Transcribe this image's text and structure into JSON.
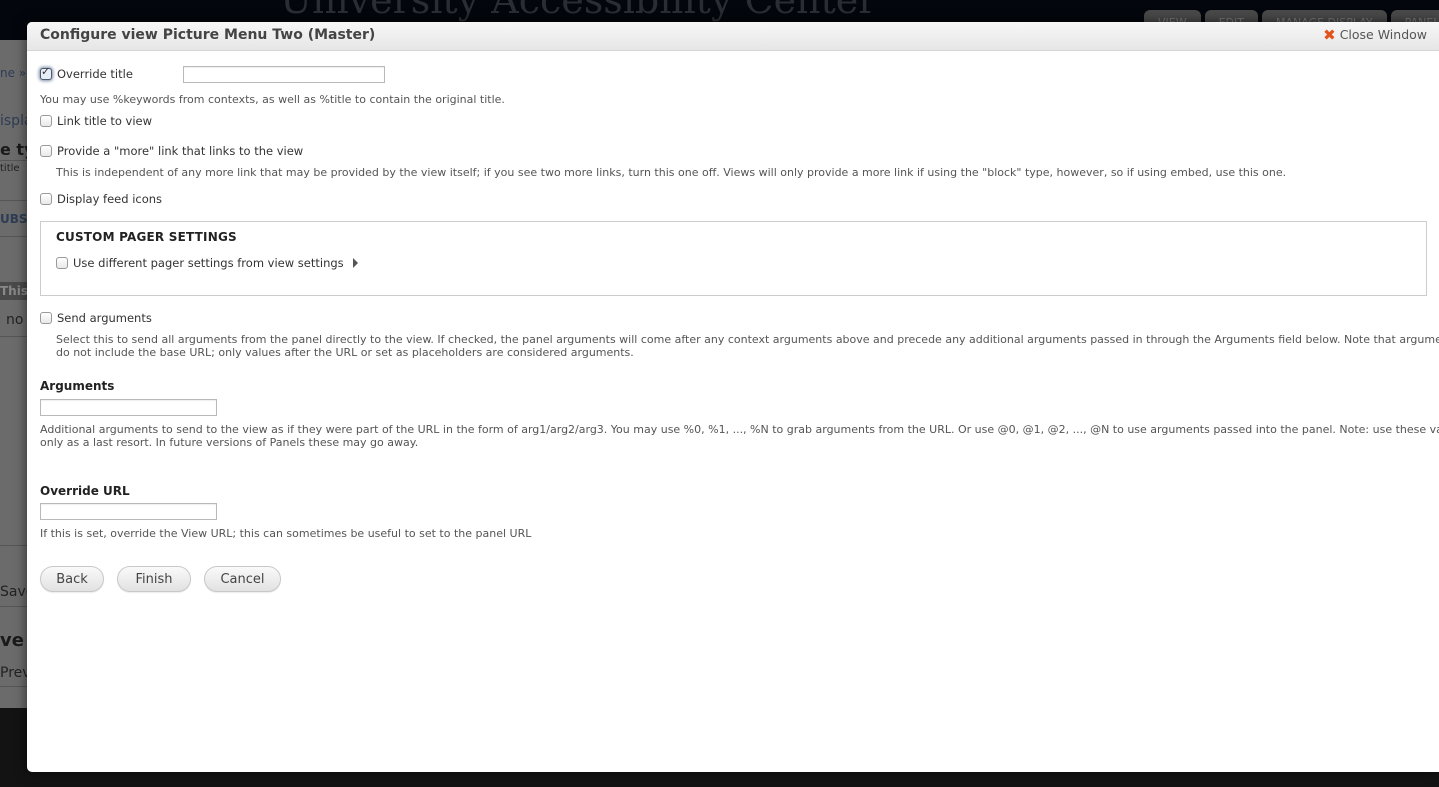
{
  "background": {
    "site_title": "University Accessibility Center",
    "tabs": [
      "VIEW",
      "EDIT",
      "MANAGE DISPLAY",
      "PANEL"
    ],
    "fragments": [
      "ne » L",
      "ispla",
      "e ty",
      "title",
      "UBS",
      "This",
      "no",
      "Save",
      "ve p",
      "Previ"
    ]
  },
  "modal": {
    "title": "Configure view Picture Menu Two (Master)",
    "close_label": "Close Window",
    "close_icon": "x-icon",
    "accent_color": "#e2531c"
  },
  "form": {
    "override_title": {
      "label": "Override title",
      "checked": true,
      "value": "",
      "help": "You may use %keywords from contexts, as well as %title to contain the original title."
    },
    "link_title": {
      "label": "Link title to view",
      "checked": false
    },
    "more_link": {
      "label": "Provide a \"more\" link that links to the view",
      "checked": false,
      "help": "This is independent of any more link that may be provided by the view itself; if you see two more links, turn this one off. Views will only provide a more link if using the \"block\" type, however, so if using embed, use this one."
    },
    "feed_icons": {
      "label": "Display feed icons",
      "checked": false
    },
    "pager": {
      "legend": "CUSTOM PAGER SETTINGS",
      "label": "Use different pager settings from view settings",
      "checked": false
    },
    "send_arguments": {
      "label": "Send arguments",
      "checked": false,
      "help_line1": "Select this to send all arguments from the panel directly to the view. If checked, the panel arguments will come after any context arguments above and precede any additional arguments passed in through the Arguments field below. Note that arguments",
      "help_line2": "do not include the base URL; only values after the URL or set as placeholders are considered arguments."
    },
    "arguments": {
      "label": "Arguments",
      "value": "",
      "help_line1": "Additional arguments to send to the view as if they were part of the URL in the form of arg1/arg2/arg3. You may use %0, %1, ..., %N to grab arguments from the URL. Or use @0, @1, @2, ..., @N to use arguments passed into the panel. Note: use these values",
      "help_line2": "only as a last resort. In future versions of Panels these may go away."
    },
    "override_url": {
      "label": "Override URL",
      "value": "",
      "help": "If this is set, override the View URL; this can sometimes be useful to set to the panel URL"
    }
  },
  "buttons": {
    "back": "Back",
    "finish": "Finish",
    "cancel": "Cancel"
  }
}
